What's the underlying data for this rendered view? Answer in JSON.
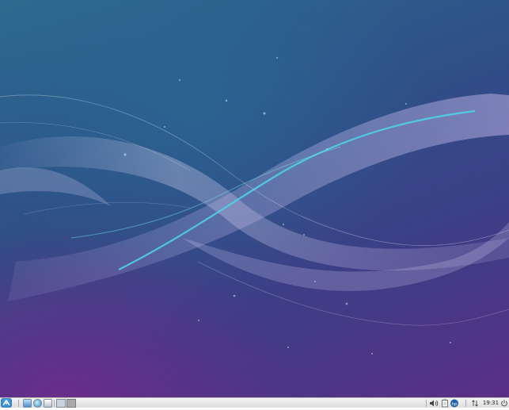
{
  "desktop": {
    "wallpaper": "lubuntu-ribbon-wallpaper",
    "colors": {
      "teal": "#2c6b8f",
      "indigo": "#3e3d86",
      "purple": "#5a2f86",
      "ribbon_light": "#c9bfe6",
      "ribbon_accent": "#4fd0e8"
    }
  },
  "taskbar": {
    "start_icon": "lubuntu-start-icon",
    "launchers": [
      {
        "name": "file-manager-icon"
      },
      {
        "name": "web-browser-icon"
      },
      {
        "name": "terminal-icon"
      }
    ],
    "workspaces": [
      {
        "name": "desktop-1"
      },
      {
        "name": "desktop-2"
      }
    ],
    "tray": {
      "volume_icon": "speaker-icon",
      "clipboard_icon": "clipboard-icon",
      "hp_icon": "hp-icon",
      "network_icon": "network-icon",
      "power_icon": "power-icon"
    },
    "clock": "19:31"
  }
}
